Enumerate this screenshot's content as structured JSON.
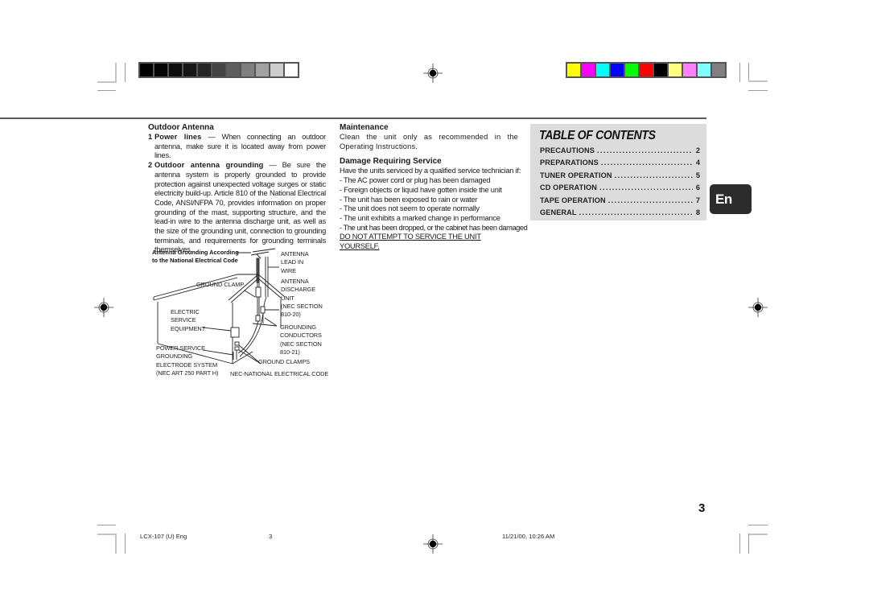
{
  "printer_marks": {
    "gray_bar": [
      "#000000",
      "#050505",
      "#0d0d0d",
      "#171717",
      "#262626",
      "#444444",
      "#5e5e5e",
      "#7f7f7f",
      "#a1a1a1",
      "#cdcdcd",
      "#ffffff"
    ],
    "color_bar": [
      "#ffff00",
      "#ff00ff",
      "#00ffff",
      "#0000ff",
      "#00ff00",
      "#ff0000",
      "#000000",
      "#ffff80",
      "#ff80ff",
      "#80ffff",
      "#808080"
    ]
  },
  "outdoor_antenna": {
    "heading": "Outdoor Antenna",
    "items": [
      {
        "num": "1",
        "title": "Power lines",
        "text": " — When connecting an outdoor antenna, make sure it is located away from power lines."
      },
      {
        "num": "2",
        "title": "Outdoor antenna grounding",
        "text": " — Be sure the antenna system is properly grounded to provide protection against unexpected voltage surges or static electricity build-up. Article 810 of the National Electrical Code, ANSI/NFPA 70, provides information on proper grounding of the mast, supporting structure, and the lead-in wire to the antenna discharge unit, as well as the size of the grounding unit, connection to grounding terminals, and requirements for grounding terminals themselves."
      }
    ]
  },
  "diagram": {
    "title_line1": "Antenna Grounding According",
    "title_line2": "to the National Electrical Code",
    "labels": {
      "antenna_lead": [
        "ANTENNA",
        "LEAD IN",
        "WIRE"
      ],
      "ground_clamp": "GROUND CLAMP",
      "discharge_unit": [
        "ANTENNA",
        "DISCHARGE",
        "UNIT",
        "(NEC SECTION",
        "810-20)"
      ],
      "electric_service": [
        "ELECTRIC",
        "SERVICE",
        "EQUIPMENT"
      ],
      "grounding_conductors": [
        "GROUNDING",
        "CONDUCTORS",
        "(NEC SECTION",
        "810-21)"
      ],
      "power_service": [
        "POWER SERVICE",
        "GROUNDING",
        "ELECTRODE SYSTEM",
        "(NEC ART 250 PART H)"
      ],
      "ground_clamps": "GROUND CLAMPS",
      "nec_note": "NEC-NATIONAL ELECTRICAL CODE"
    }
  },
  "maintenance": {
    "heading": "Maintenance",
    "text": "Clean the unit only as recommended in the Operating Instructions."
  },
  "damage": {
    "heading": "Damage Requiring Service",
    "intro": "Have the units serviced by a qualified service technician if:",
    "items": [
      "- The AC power cord or plug has been damaged",
      "- Foreign objects or liquid have gotten inside the unit",
      "- The unit has been exposed to rain or water",
      "- The unit does not seem to operate normally",
      "- The unit exhibits a marked change in performance",
      "- The unit has been dropped, or the cabinet has been damaged"
    ],
    "warning": "DO NOT ATTEMPT TO SERVICE THE UNIT YOURSELF."
  },
  "toc": {
    "title": "TABLE OF CONTENTS",
    "entries": [
      {
        "label": "PRECAUTIONS",
        "page": "2"
      },
      {
        "label": "PREPARATIONS",
        "page": "4"
      },
      {
        "label": "TUNER OPERATION",
        "page": "5"
      },
      {
        "label": "CD OPERATION",
        "page": "6"
      },
      {
        "label": "TAPE OPERATION",
        "page": "7"
      },
      {
        "label": "GENERAL",
        "page": "8"
      }
    ],
    "dots": "........................................................................"
  },
  "language_tab": "En",
  "page_number": "3",
  "footer": {
    "doc_id": "LCX-107 (U) Eng",
    "page": "3",
    "timestamp": "11/21/00, 10:26 AM"
  }
}
